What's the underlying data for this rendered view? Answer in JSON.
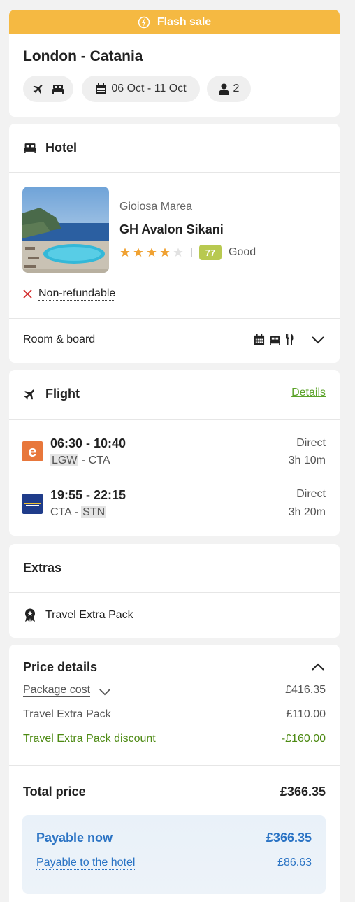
{
  "banner": {
    "label": "Flash sale",
    "color": "#f5b942"
  },
  "trip": {
    "title": "London - Catania",
    "pills": {
      "dates": "06 Oct - 11 Oct",
      "travellers": "2"
    }
  },
  "hotel": {
    "section_title": "Hotel",
    "city": "Gioiosa Marea",
    "name": "GH Avalon Sikani",
    "stars": 4,
    "max_stars": 5,
    "score": "77",
    "score_text": "Good",
    "refund_policy": "Non-refundable",
    "room_board_label": "Room & board"
  },
  "flight": {
    "section_title": "Flight",
    "details_link": "Details",
    "legs": [
      {
        "airline_icon": "easyjet-logo",
        "times": "06:30 - 10:40",
        "from": "LGW",
        "sep": " - ",
        "to": "CTA",
        "type": "Direct",
        "duration": "3h 10m"
      },
      {
        "airline_icon": "ryanair-logo",
        "times": "19:55 - 22:15",
        "from": "CTA",
        "sep": " - ",
        "to": "STN",
        "type": "Direct",
        "duration": "3h 20m"
      }
    ]
  },
  "extras": {
    "section_title": "Extras",
    "items": [
      "Travel Extra Pack"
    ]
  },
  "price": {
    "section_title": "Price details",
    "rows": [
      {
        "label": "Package cost",
        "value": "£416.35"
      },
      {
        "label": "Travel Extra Pack",
        "value": "£110.00"
      },
      {
        "label": "Travel Extra Pack discount",
        "value": "-£160.00"
      }
    ],
    "total_label": "Total price",
    "total_value": "£366.35",
    "payable_now_label": "Payable now",
    "payable_now_value": "£366.35",
    "payable_hotel_label": "Payable to the hotel",
    "payable_hotel_value": "£86.63"
  },
  "colors": {
    "accent_green": "#5ca32a",
    "discount_green": "#4d8a13",
    "link_blue": "#2a73c4",
    "score_badge": "#b8c950",
    "star": "#f0a233",
    "error_red": "#d32f2f"
  }
}
